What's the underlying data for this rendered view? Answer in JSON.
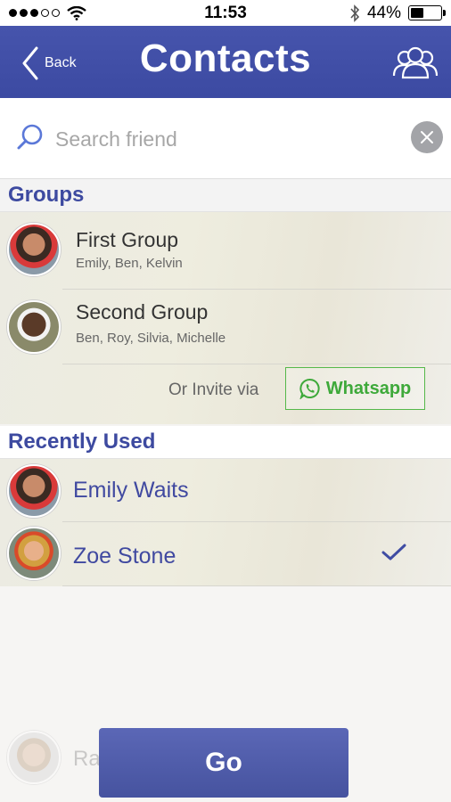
{
  "status_bar": {
    "time": "11:53",
    "battery": "44%"
  },
  "nav": {
    "back_label": "Back",
    "title": "Contacts"
  },
  "search": {
    "placeholder": "Search friend",
    "value": ""
  },
  "groups_section": {
    "header": "Groups",
    "items": [
      {
        "name": "First Group",
        "members": "Emily, Ben, Kelvin"
      },
      {
        "name": "Second Group",
        "members": "Ben, Roy, Silvia, Michelle"
      }
    ],
    "invite_text": "Or Invite via",
    "invite_button": "Whatsapp"
  },
  "recent_section": {
    "header": "Recently Used",
    "items": [
      {
        "name": "Emily Waits",
        "selected": false
      },
      {
        "name": "Zoe Stone",
        "selected": true
      }
    ]
  },
  "faded_contact": {
    "name": "Ra"
  },
  "go_button": "Go",
  "colors": {
    "primary": "#3f4ca3",
    "whatsapp_green": "#3ea93a",
    "clear_button": "#a3a4a8"
  }
}
